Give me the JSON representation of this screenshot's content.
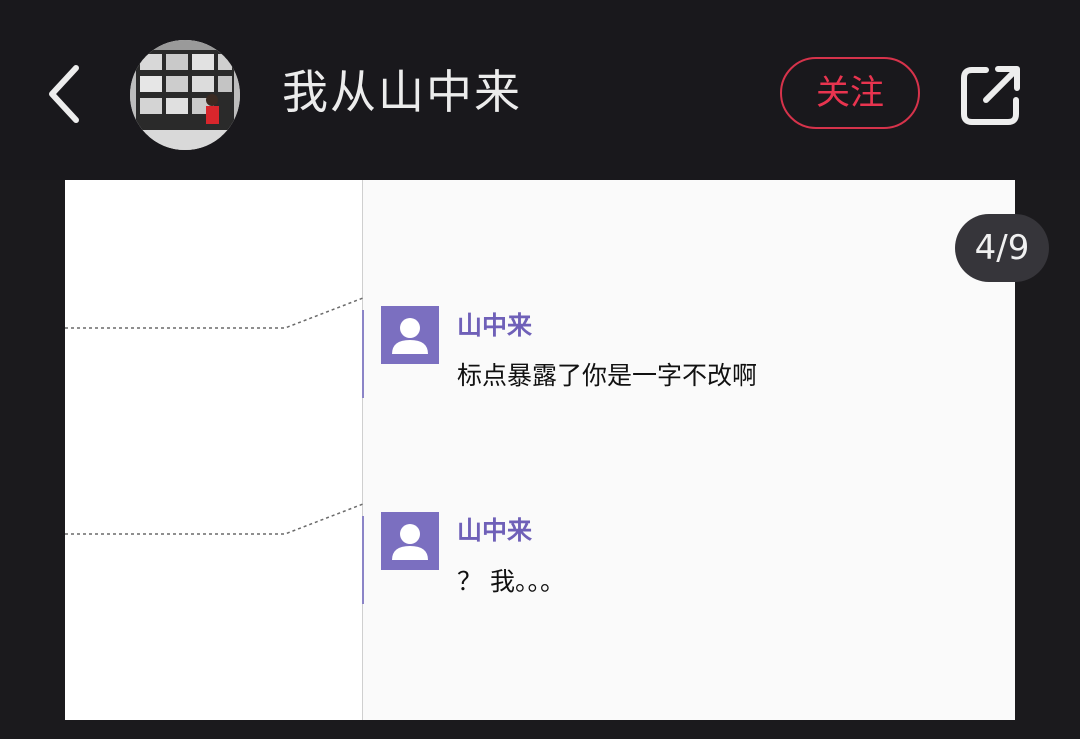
{
  "header": {
    "username": "我从山中来",
    "follow_label": "关注",
    "back_icon": "chevron-left-icon",
    "share_icon": "share-external-icon",
    "accent_color": "#e8344f"
  },
  "viewer": {
    "page_indicator": "4/9",
    "current_page": 4,
    "total_pages": 9
  },
  "comments": [
    {
      "author": "山中来",
      "text": "标点暴露了你是一字不改啊"
    },
    {
      "author": "山中来",
      "text": "？ 我。。。"
    }
  ]
}
